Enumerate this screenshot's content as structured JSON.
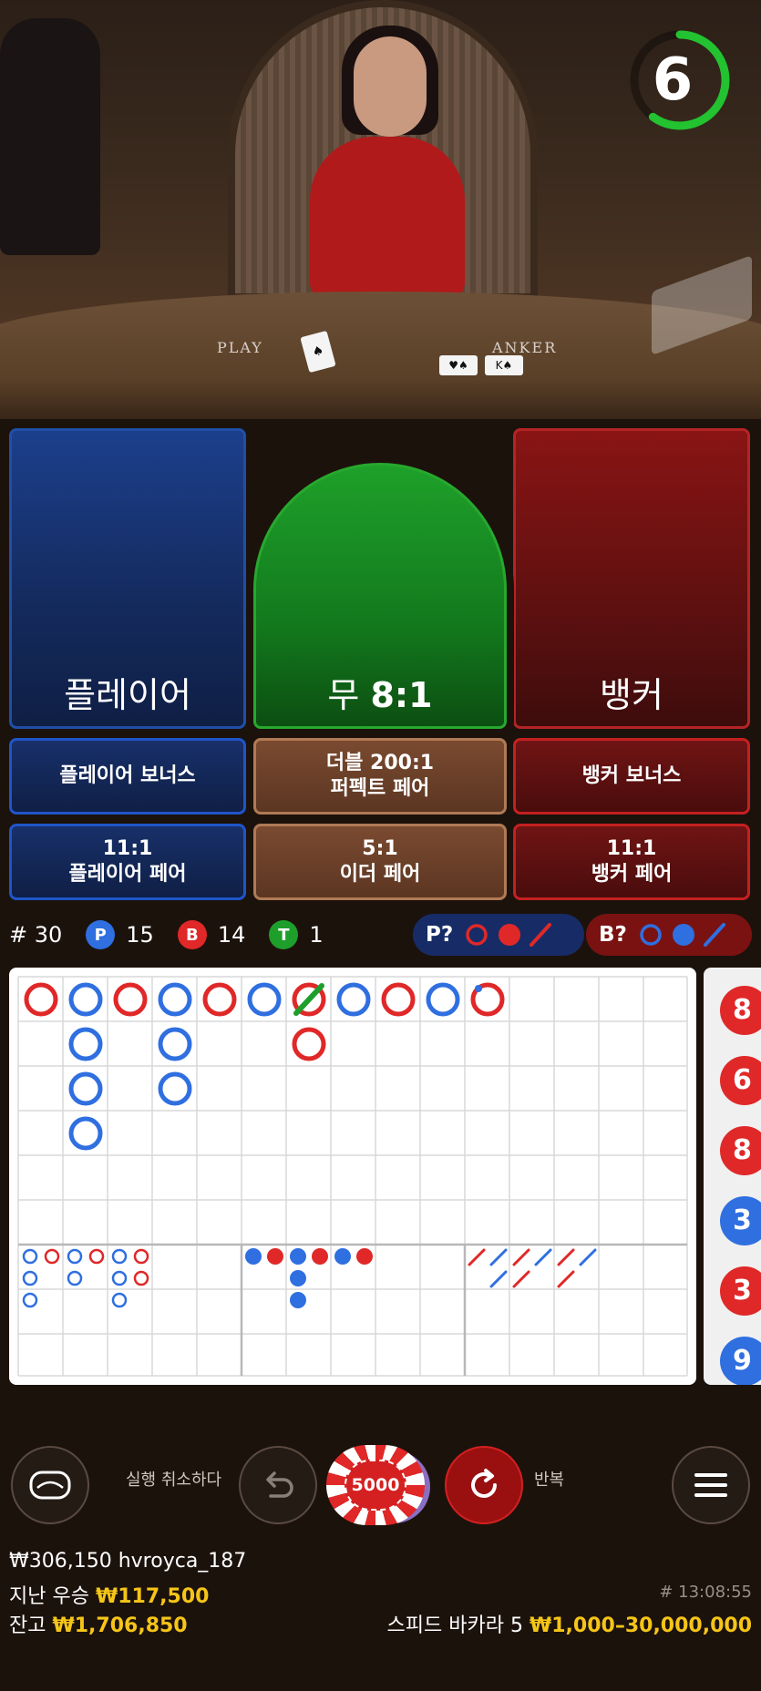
{
  "video": {
    "countdown": "6",
    "countdown_fraction": 0.6,
    "felt_player": "PLAY",
    "felt_banker": "ANKER"
  },
  "bets": {
    "player_label": "플레이어",
    "banker_label": "뱅커",
    "tie_label": "무",
    "tie_odds": "8:1",
    "player_bonus": "플레이어 보너스",
    "perfect_pair_line1": "더블 200:1",
    "perfect_pair_line2": "퍼펙트 페어",
    "banker_bonus": "뱅커 보너스",
    "player_pair_odds": "11:1",
    "player_pair": "플레이어 페어",
    "either_pair_odds": "5:1",
    "either_pair": "이더 페어",
    "banker_pair_odds": "11:1",
    "banker_pair": "뱅커 페어"
  },
  "stats": {
    "rounds_label": "# 30",
    "p_letter": "P",
    "p_count": "15",
    "b_letter": "B",
    "b_count": "14",
    "t_letter": "T",
    "t_count": "1",
    "ask_player": "P?",
    "ask_banker": "B?"
  },
  "side_road": [
    "8",
    "6",
    "8",
    "3",
    "3",
    "9"
  ],
  "controls": {
    "undo_label": "실행 취소하다",
    "chip_value": "5000",
    "repeat_label": "반복"
  },
  "footer": {
    "last_win_line": "₩306,150 hvroyca_187",
    "prev_win_label": "지난 우승",
    "prev_win_amount": "₩117,500",
    "balance_label": "잔고",
    "balance_amount": "₩1,706,850",
    "round_id": "# 13:08:55",
    "table_name": "스피드 바카라 5",
    "limits": "₩1,000–30,000,000"
  },
  "colors": {
    "player": "#2f6fe0",
    "banker": "#e02828",
    "tie": "#1e9e2a",
    "gold": "#f5c518"
  }
}
